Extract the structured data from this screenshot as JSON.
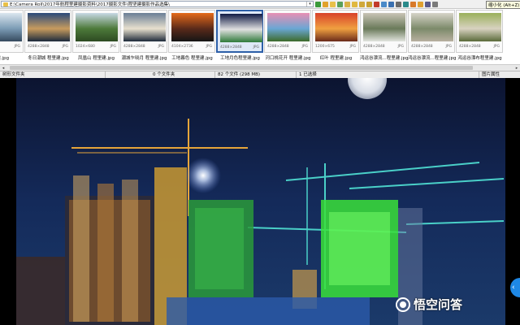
{
  "address_bar": {
    "path": "E:\\Camera Roll\\2017年航程里建摄影资料\\2017摄影文件\\程坚建摄影作品选集\\"
  },
  "tooltip": "缩小化 (Alt+Z)",
  "thumbnails": [
    {
      "caption": "里建.jpg",
      "dims": "",
      "ext": "JPG",
      "selected": false,
      "palette": [
        "#dbe6ee",
        "#7b9bb5",
        "#364a5e"
      ]
    },
    {
      "caption": "冬日潮城 程里建.jpg",
      "dims": "4288×2848",
      "ext": "JPG",
      "selected": false,
      "palette": [
        "#2a4a7a",
        "#c79b5e",
        "#1c2a3c"
      ]
    },
    {
      "caption": "凤凰山 程里建.jpg",
      "dims": "1024×680",
      "ext": "JPG",
      "selected": false,
      "palette": [
        "#c7d8e4",
        "#4d7a3a",
        "#2d4a22"
      ]
    },
    {
      "caption": "潮城乍晓月 程里建.jpg",
      "dims": "4288×2848",
      "ext": "JPG",
      "selected": false,
      "palette": [
        "#6a7e96",
        "#e8e0ce",
        "#1e2a3a"
      ]
    },
    {
      "caption": "工地暮色 程里建.jpg",
      "dims": "4104×2736",
      "ext": "JPG",
      "selected": false,
      "palette": [
        "#e46a1a",
        "#5a2a1a",
        "#151515"
      ]
    },
    {
      "caption": "工地月色程里建.jpg",
      "dims": "4288×2848",
      "ext": "JPG",
      "selected": true,
      "palette": [
        "#101a44",
        "#e0e0e0",
        "#2f7a3a"
      ]
    },
    {
      "caption": "河口桃花开 程里建.jpg",
      "dims": "4288×2848",
      "ext": "JPG",
      "selected": false,
      "palette": [
        "#e88fb4",
        "#6aa7d4",
        "#3d6a2a"
      ]
    },
    {
      "caption": "红叶 程里建.jpg",
      "dims": "1200×675",
      "ext": "JPG",
      "selected": false,
      "palette": [
        "#d8422a",
        "#f0a040",
        "#6a2a1a"
      ]
    },
    {
      "caption": "鸿运谷漂流...程里建.jpg",
      "dims": "4288×2848",
      "ext": "JPG",
      "selected": false,
      "palette": [
        "#c9c4b6",
        "#6a7a5a",
        "#e2e4de"
      ]
    },
    {
      "caption": "鸿运谷漂流...程里建.jpg",
      "dims": "4288×2848",
      "ext": "JPG",
      "selected": false,
      "palette": [
        "#d6d3c8",
        "#7c8a6a",
        "#b8b0a0"
      ]
    },
    {
      "caption": "鸿运谷漂布程里建.jpg",
      "dims": "4288×2848",
      "ext": "JPG",
      "selected": false,
      "palette": [
        "#9ab05a",
        "#d8d2c0",
        "#5a6a3a"
      ]
    }
  ],
  "status": {
    "tree": "树形文件夹",
    "folders": "0 个文件夹",
    "files": "82 个文件 (298 MB)",
    "selected": "1 已选择",
    "viewer": "图片属性"
  },
  "watermark": "悟空问答",
  "colors": {
    "selection_border": "#2d5fa8",
    "accent_blue": "#1e88e5"
  }
}
